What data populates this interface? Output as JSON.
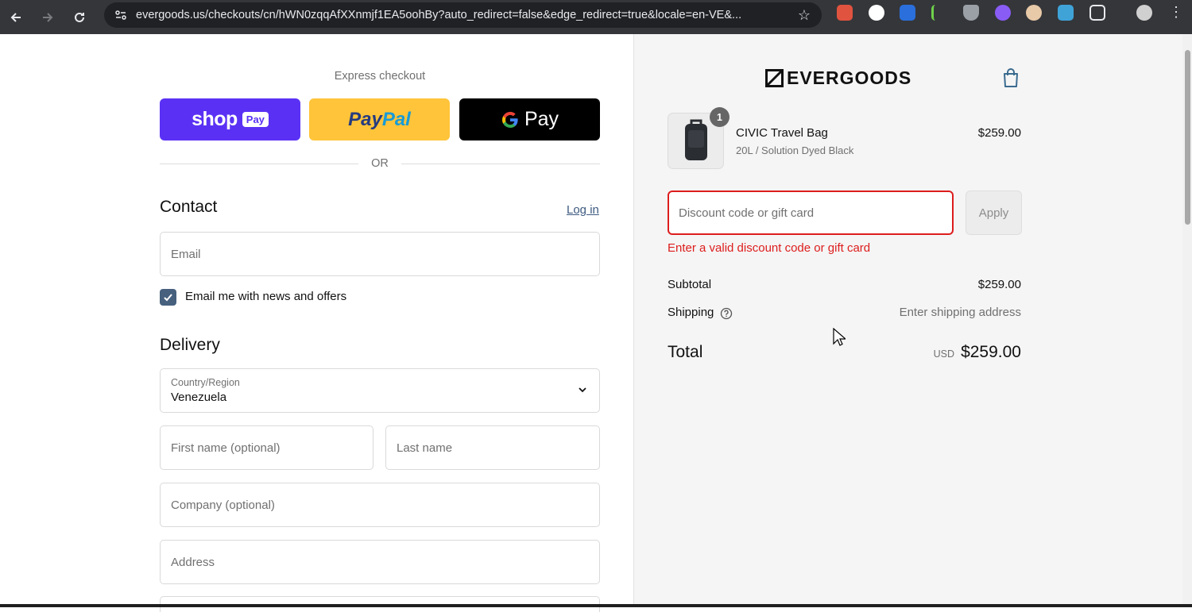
{
  "browser": {
    "url": "evergoods.us/checkouts/cn/hWN0zqqAfXXnmjf1EA5oohBy?auto_redirect=false&edge_redirect=true&locale=en-VE&..."
  },
  "checkout": {
    "express_title": "Express checkout",
    "shop_pay_word": "shop",
    "shop_pay_badge": "Pay",
    "paypal_part1": "Pay",
    "paypal_part2": "Pal",
    "gpay_word": "Pay",
    "or_text": "OR",
    "contact": {
      "title": "Contact",
      "login_link": "Log in",
      "email_placeholder": "Email",
      "newsletter_label": "Email me with news and offers",
      "newsletter_checked": true
    },
    "delivery": {
      "title": "Delivery",
      "country_label": "Country/Region",
      "country_value": "Venezuela",
      "first_name_placeholder": "First name (optional)",
      "last_name_placeholder": "Last name",
      "company_placeholder": "Company (optional)",
      "address_placeholder": "Address"
    }
  },
  "summary": {
    "brand": "EVERGOODS",
    "item": {
      "quantity": "1",
      "name": "CIVIC Travel Bag",
      "variant": "20L / Solution Dyed Black",
      "price": "$259.00"
    },
    "discount_placeholder": "Discount code or gift card",
    "apply_label": "Apply",
    "discount_error": "Enter a valid discount code or gift card",
    "subtotal_label": "Subtotal",
    "subtotal_value": "$259.00",
    "shipping_label": "Shipping",
    "shipping_value": "Enter shipping address",
    "total_label": "Total",
    "total_currency": "USD",
    "total_value": "$259.00"
  },
  "colors": {
    "shop_pay": "#5a31f4",
    "paypal": "#ffc439",
    "gpay": "#000000",
    "error": "#dd1d1d",
    "checkbox": "#46607e"
  }
}
